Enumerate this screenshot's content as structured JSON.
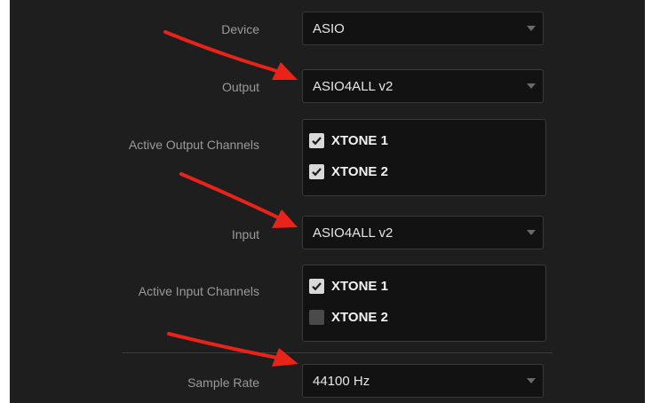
{
  "settings": {
    "device": {
      "label": "Device",
      "value": "ASIO"
    },
    "output": {
      "label": "Output",
      "value": "ASIO4ALL v2"
    },
    "active_output_channels": {
      "label": "Active Output Channels",
      "channels": [
        {
          "name": "XTONE 1",
          "checked": true
        },
        {
          "name": "XTONE 2",
          "checked": true
        }
      ]
    },
    "input": {
      "label": "Input",
      "value": "ASIO4ALL v2"
    },
    "active_input_channels": {
      "label": "Active Input Channels",
      "channels": [
        {
          "name": "XTONE 1",
          "checked": true
        },
        {
          "name": "XTONE 2",
          "checked": false
        }
      ]
    },
    "sample_rate": {
      "label": "Sample Rate",
      "value": "44100 Hz"
    }
  },
  "colors": {
    "panel_bg": "#1e1e1e",
    "field_bg": "#121212",
    "label_text": "#9a9a9a",
    "value_text": "#e6e6e6",
    "annotation_arrow": "#e8231a"
  }
}
